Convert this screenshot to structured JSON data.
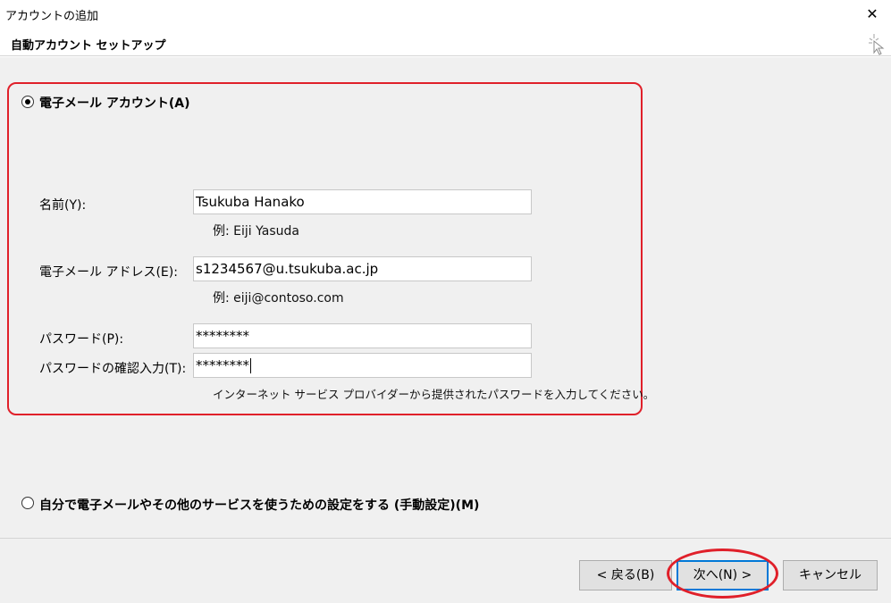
{
  "window": {
    "title": "アカウントの追加",
    "close_glyph": "✕"
  },
  "header": {
    "title": "自動アカウント セットアップ",
    "icon": "wizard-sparkle-icon"
  },
  "email_account": {
    "radio_label": "電子メール アカウント(A)",
    "selected": true,
    "name_label": "名前(Y):",
    "name_value": "Tsukuba Hanako",
    "name_hint": "例: Eiji Yasuda",
    "email_label": "電子メール アドレス(E):",
    "email_value": "s1234567@u.tsukuba.ac.jp",
    "email_hint": "例: eiji@contoso.com",
    "password_label": "パスワード(P):",
    "password_value": "********",
    "confirm_label": "パスワードの確認入力(T):",
    "confirm_value": "********",
    "password_hint": "インターネット サービス プロバイダーから提供されたパスワードを入力してください。"
  },
  "manual_setup": {
    "radio_label": "自分で電子メールやその他のサービスを使うための設定をする (手動設定)(M)",
    "selected": false
  },
  "buttons": {
    "back": "< 戻る(B)",
    "next": "次へ(N) >",
    "cancel": "キャンセル"
  },
  "colors": {
    "highlight": "#e0202a",
    "background": "#f0f0f0",
    "default_button_border": "#0078d7"
  }
}
